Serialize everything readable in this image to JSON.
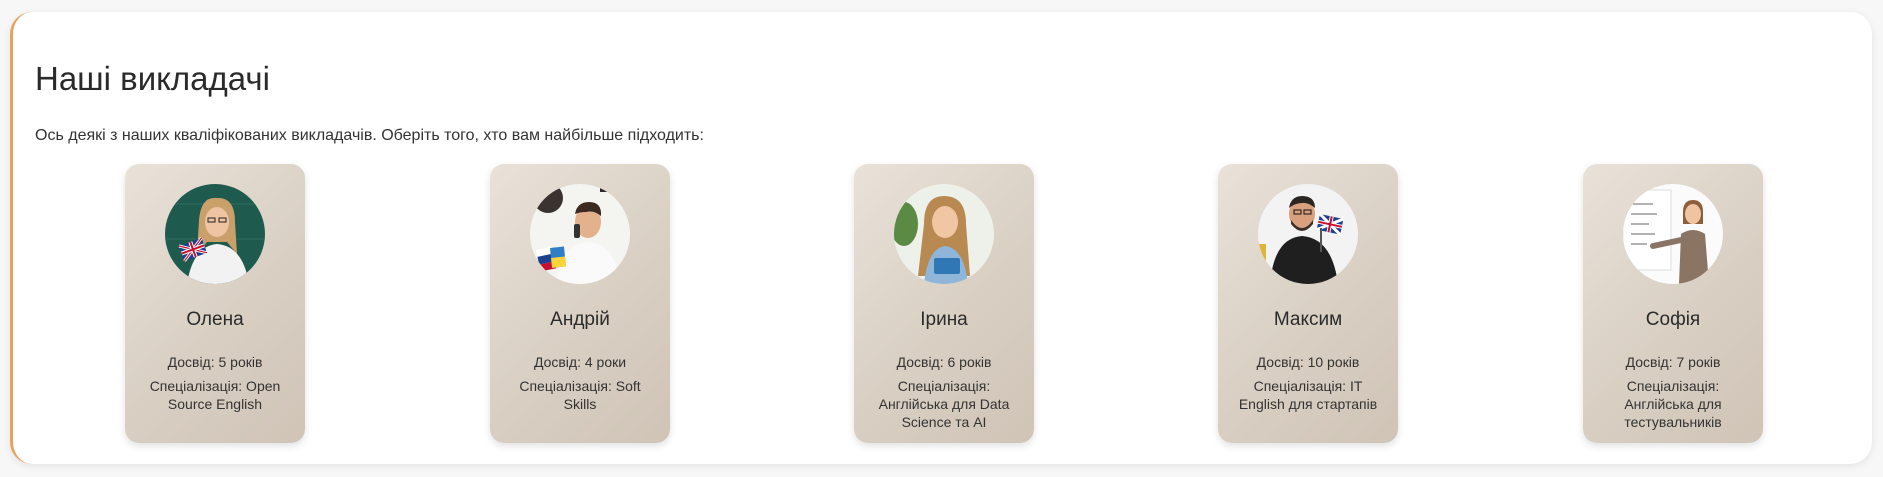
{
  "section": {
    "title": "Наші викладачі",
    "intro": "Ось деякі з наших кваліфікованих викладачів. Оберіть того, хто вам найбільше підходить:"
  },
  "teachers": [
    {
      "name": "Олена",
      "experience": "Досвід: 5 років",
      "specialization": "Спеціалізація: Open Source English"
    },
    {
      "name": "Андрій",
      "experience": "Досвід: 4 роки",
      "specialization": "Спеціалізація: Soft Skills"
    },
    {
      "name": "Ірина",
      "experience": "Досвід: 6 років",
      "specialization": "Спеціалізація: Англійська для Data Science та AI"
    },
    {
      "name": "Максим",
      "experience": "Досвід: 10 років",
      "specialization": "Спеціалізація: IT English для стартапів"
    },
    {
      "name": "Софія",
      "experience": "Досвід: 7 років",
      "specialization": "Спеціалізація: Англійська для тестувальників"
    }
  ],
  "colors": {
    "accent": "#e8a25c",
    "card_light": "#e9e2d9",
    "card_dark": "#cfc4b6"
  }
}
